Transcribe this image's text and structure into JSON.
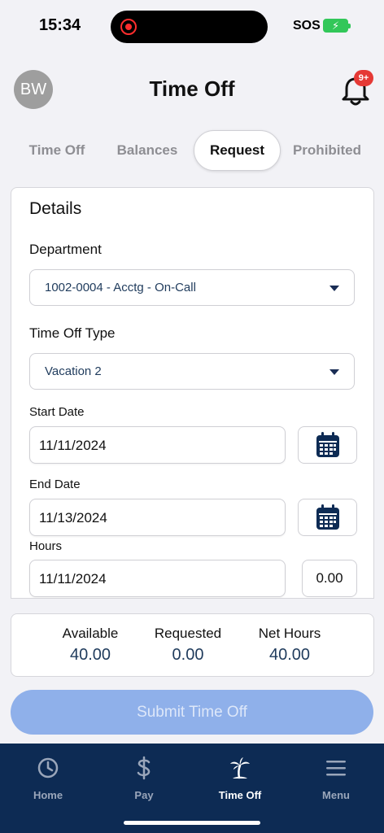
{
  "status_bar": {
    "time": "15:34",
    "carrier": "SOS"
  },
  "header": {
    "avatar_initials": "BW",
    "title": "Time Off",
    "notification_badge": "9+"
  },
  "tabs": [
    {
      "label": "Time Off",
      "active": false
    },
    {
      "label": "Balances",
      "active": false
    },
    {
      "label": "Request",
      "active": true
    },
    {
      "label": "Prohibited",
      "active": false
    }
  ],
  "details": {
    "title": "Details",
    "department_label": "Department",
    "department_value": "1002-0004 - Acctg - On-Call",
    "type_label": "Time Off Type",
    "type_value": "Vacation 2",
    "start_label": "Start Date",
    "start_value": "11/11/2024",
    "end_label": "End Date",
    "end_value": "11/13/2024",
    "hours_label": "Hours",
    "hours_date_value": "11/11/2024",
    "hours_value": "0.00"
  },
  "summary": {
    "available_label": "Available",
    "available_value": "40.00",
    "requested_label": "Requested",
    "requested_value": "0.00",
    "net_label": "Net Hours",
    "net_value": "40.00"
  },
  "submit_label": "Submit Time Off",
  "bottom_nav": [
    {
      "label": "Home",
      "icon": "clock-icon",
      "active": false
    },
    {
      "label": "Pay",
      "icon": "dollar-icon",
      "active": false
    },
    {
      "label": "Time Off",
      "icon": "palm-tree-icon",
      "active": true
    },
    {
      "label": "Menu",
      "icon": "hamburger-menu-icon",
      "active": false
    }
  ],
  "colors": {
    "navy": "#0d2b54",
    "submit_disabled": "#8fb0ea",
    "badge_red": "#e53935",
    "value_text": "#1f3b5c"
  }
}
